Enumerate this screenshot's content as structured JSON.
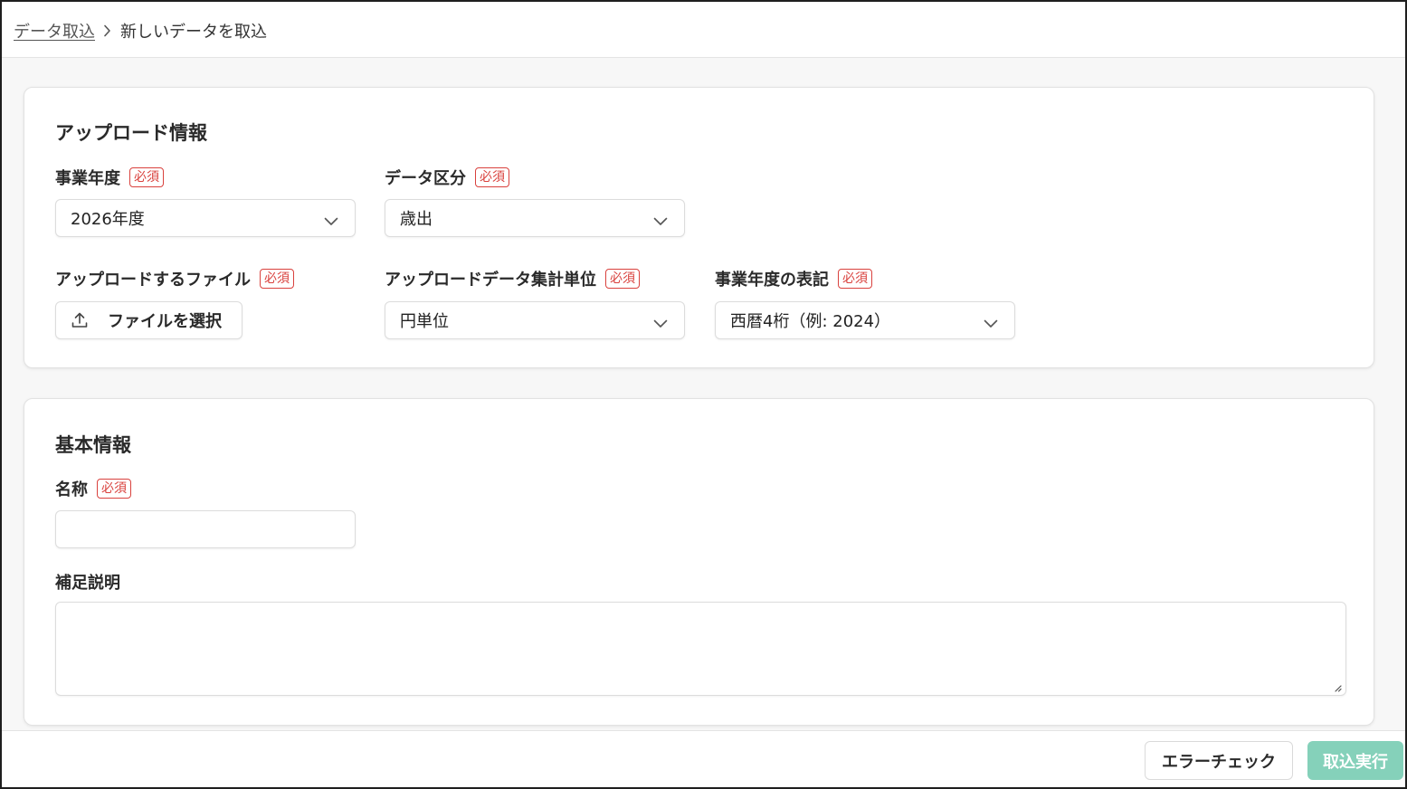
{
  "breadcrumb": {
    "parent": "データ取込",
    "current": "新しいデータを取込"
  },
  "required_badge": "必須",
  "upload_section": {
    "title": "アップロード情報",
    "fiscal_year": {
      "label": "事業年度",
      "value": "2026年度"
    },
    "data_category": {
      "label": "データ区分",
      "value": "歳出"
    },
    "upload_file": {
      "label": "アップロードするファイル",
      "button": "ファイルを選択"
    },
    "aggregation_unit": {
      "label": "アップロードデータ集計単位",
      "value": "円単位"
    },
    "year_notation": {
      "label": "事業年度の表記",
      "value": "西暦4桁（例: 2024）"
    }
  },
  "basic_section": {
    "title": "基本情報",
    "name": {
      "label": "名称",
      "value": "",
      "placeholder": ""
    },
    "description": {
      "label": "補足説明",
      "value": "",
      "placeholder": ""
    }
  },
  "footer": {
    "error_check": "エラーチェック",
    "execute": "取込実行"
  },
  "colors": {
    "required": "#d9413d",
    "execute_button": "#85d1ba"
  }
}
